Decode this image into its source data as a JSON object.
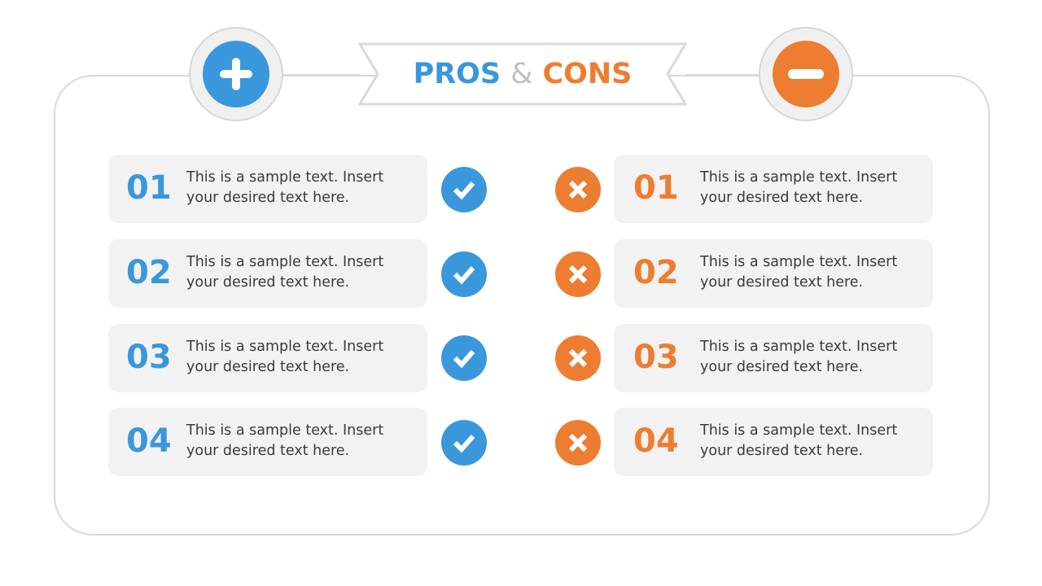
{
  "colors": {
    "pros": "#3a97dc",
    "cons": "#ed7d31",
    "ampersand": "#bfbfbf",
    "card_bg": "#f2f2f2",
    "text": "#3a3a3a"
  },
  "header": {
    "pros_label": "PROS",
    "ampersand": "&",
    "cons_label": "CONS",
    "left_icon": "plus-icon",
    "right_icon": "minus-icon"
  },
  "pros": [
    {
      "number": "01",
      "text": "This is a sample text. Insert your desired text here.",
      "icon": "check-icon"
    },
    {
      "number": "02",
      "text": "This is a sample text. Insert your desired text here.",
      "icon": "check-icon"
    },
    {
      "number": "03",
      "text": "This is a sample text. Insert your desired text here.",
      "icon": "check-icon"
    },
    {
      "number": "04",
      "text": "This is a sample text. Insert your desired text here.",
      "icon": "check-icon"
    }
  ],
  "cons": [
    {
      "number": "01",
      "text": "This is a sample text. Insert your desired text here.",
      "icon": "x-icon"
    },
    {
      "number": "02",
      "text": "This is a sample text. Insert your desired text here.",
      "icon": "x-icon"
    },
    {
      "number": "03",
      "text": "This is a sample text. Insert your desired text here.",
      "icon": "x-icon"
    },
    {
      "number": "04",
      "text": "This is a sample text. Insert your desired text here.",
      "icon": "x-icon"
    }
  ]
}
